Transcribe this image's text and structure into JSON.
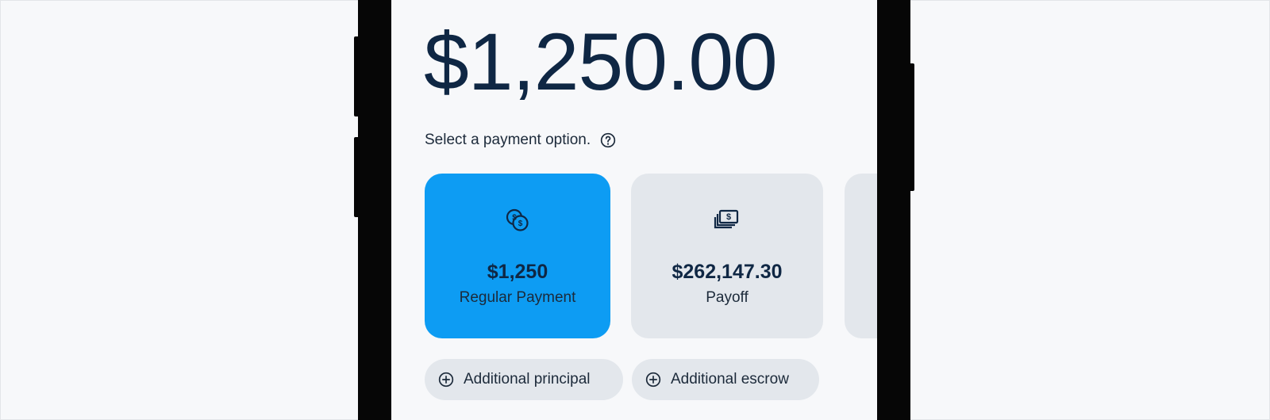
{
  "payment": {
    "amount": "$1,250.00",
    "prompt": "Select a payment option."
  },
  "options": [
    {
      "value": "$1,250",
      "label": "Regular Payment",
      "icon": "coins-icon",
      "selected": true
    },
    {
      "value": "$262,147.30",
      "label": "Payoff",
      "icon": "cash-stack-icon",
      "selected": false
    }
  ],
  "chips": {
    "principal": "Additional principal",
    "escrow": "Additional escrow"
  },
  "colors": {
    "selected": "#0d9cf3",
    "card": "#e3e7ec",
    "text": "#0f2744",
    "background": "#f7f8fa"
  }
}
